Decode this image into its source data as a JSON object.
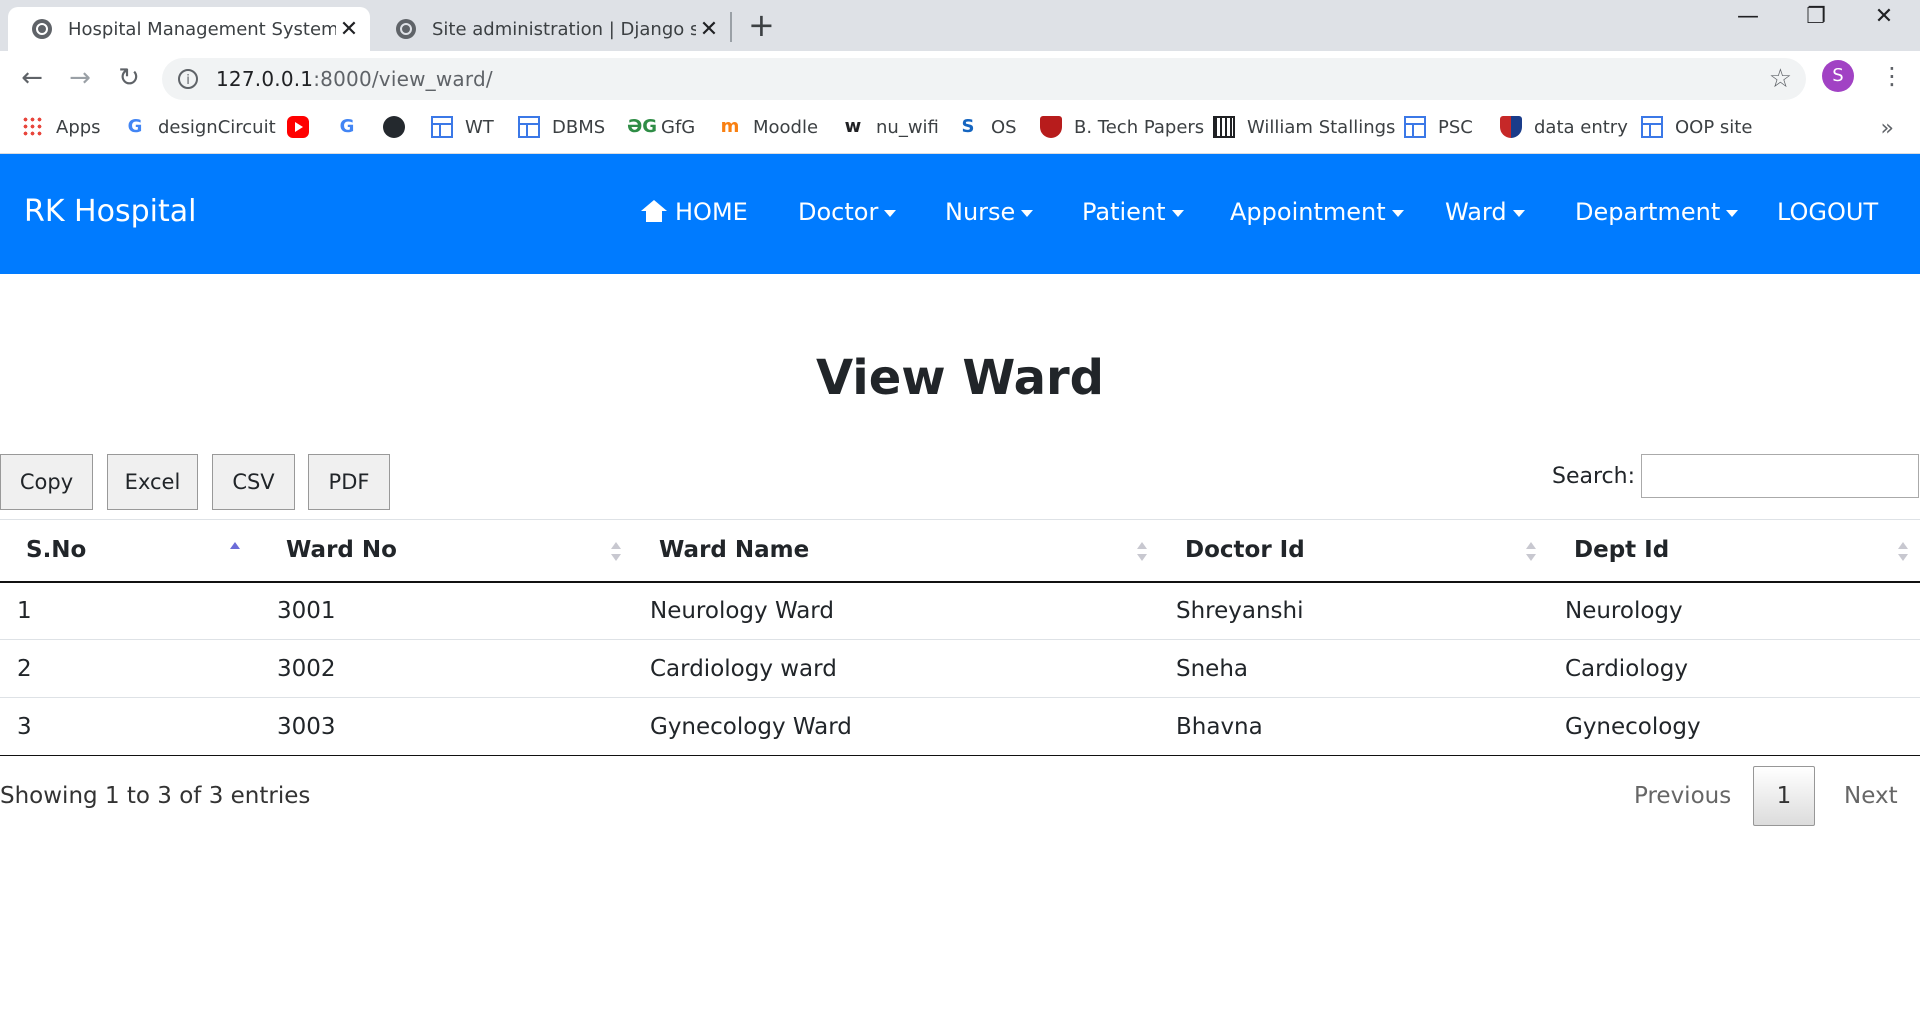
{
  "browser": {
    "tabs": [
      {
        "title": "Hospital Management System",
        "active": true
      },
      {
        "title": "Site administration | Django site admin",
        "active": false
      }
    ],
    "url_host": "127.0.0.1",
    "url_path": ":8000/view_ward/",
    "profile_initial": "S",
    "bookmarks": [
      {
        "label": "Apps",
        "icon": "apps-grid-icon"
      },
      {
        "label": "designCircuit",
        "icon": "google-icon"
      },
      {
        "label": "",
        "icon": "youtube-icon"
      },
      {
        "label": "",
        "icon": "google-icon"
      },
      {
        "label": "",
        "icon": "github-icon"
      },
      {
        "label": "WT",
        "icon": "page-icon"
      },
      {
        "label": "DBMS",
        "icon": "page-icon"
      },
      {
        "label": "GfG",
        "icon": "gfg-icon"
      },
      {
        "label": "Moodle",
        "icon": "moodle-icon"
      },
      {
        "label": "nu_wifi",
        "icon": "w-icon"
      },
      {
        "label": "OS",
        "icon": "s-icon"
      },
      {
        "label": "B. Tech Papers",
        "icon": "shield-icon"
      },
      {
        "label": "William Stallings",
        "icon": "institution-icon"
      },
      {
        "label": "PSC",
        "icon": "page-icon"
      },
      {
        "label": "data entry",
        "icon": "shield-icon"
      },
      {
        "label": "OOP site",
        "icon": "page-icon"
      }
    ]
  },
  "navbar": {
    "brand": "RK Hospital",
    "items": [
      {
        "label": "HOME",
        "dropdown": false
      },
      {
        "label": "Doctor",
        "dropdown": true
      },
      {
        "label": "Nurse",
        "dropdown": true
      },
      {
        "label": "Patient",
        "dropdown": true
      },
      {
        "label": "Appointment",
        "dropdown": true
      },
      {
        "label": "Ward",
        "dropdown": true
      },
      {
        "label": "Department",
        "dropdown": true
      },
      {
        "label": "LOGOUT",
        "dropdown": false
      }
    ],
    "color": "#007bff"
  },
  "page": {
    "title": "View Ward",
    "export_buttons": [
      "Copy",
      "Excel",
      "CSV",
      "PDF"
    ],
    "search_label": "Search:",
    "search_value": ""
  },
  "table": {
    "columns": [
      "S.No",
      "Ward No",
      "Ward Name",
      "Doctor Id",
      "Dept Id"
    ],
    "sorted_column": "S.No",
    "rows": [
      [
        "1",
        "3001",
        "Neurology Ward",
        "Shreyanshi",
        "Neurology"
      ],
      [
        "2",
        "3002",
        "Cardiology ward",
        "Sneha",
        "Cardiology"
      ],
      [
        "3",
        "3003",
        "Gynecology Ward",
        "Bhavna",
        "Gynecology"
      ]
    ]
  },
  "pagination": {
    "info": "Showing 1 to 3 of 3 entries",
    "previous": "Previous",
    "current_page": "1",
    "next": "Next"
  }
}
